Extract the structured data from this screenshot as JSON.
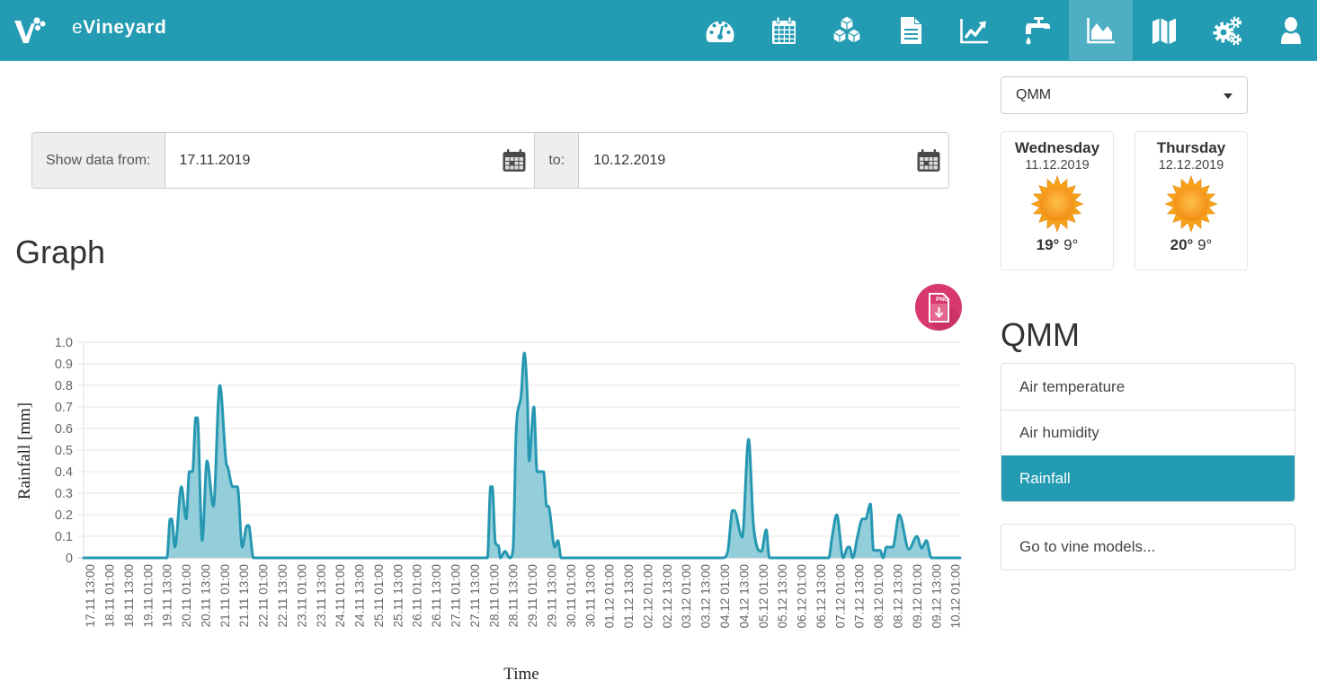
{
  "app": {
    "title_prefix": "e",
    "title_main": "Vineyard"
  },
  "nav": {
    "items": [
      {
        "name": "dashboard",
        "active": false
      },
      {
        "name": "calendar",
        "active": false
      },
      {
        "name": "cubes",
        "active": false
      },
      {
        "name": "documents",
        "active": false
      },
      {
        "name": "line-chart",
        "active": false
      },
      {
        "name": "irrigation",
        "active": false
      },
      {
        "name": "area-chart",
        "active": true
      },
      {
        "name": "map",
        "active": false
      },
      {
        "name": "settings",
        "active": false
      },
      {
        "name": "user",
        "active": false
      }
    ]
  },
  "date_range": {
    "from_label": "Show data from:",
    "from_value": "17.11.2019",
    "to_label": "to:",
    "to_value": "10.12.2019"
  },
  "graph": {
    "title": "Graph",
    "export_label": "PNG"
  },
  "station_select": {
    "value": "QMM"
  },
  "forecast": [
    {
      "day": "Wednesday",
      "date": "11.12.2019",
      "high": "19°",
      "low": "9°",
      "icon": "sunny"
    },
    {
      "day": "Thursday",
      "date": "12.12.2019",
      "high": "20°",
      "low": "9°",
      "icon": "sunny"
    }
  ],
  "sidebar": {
    "title": "QMM",
    "items": [
      {
        "label": "Air temperature",
        "active": false
      },
      {
        "label": "Air humidity",
        "active": false
      },
      {
        "label": "Rainfall",
        "active": true
      }
    ],
    "vine_models": "Go to vine models..."
  },
  "colors": {
    "brand": "#229bb3",
    "nav_active": "#4eafc4",
    "series_line": "#2698b2",
    "series_fill": "#8ecbd8",
    "export_button": "#d6386f",
    "sun": "#f7a21b"
  },
  "chart_data": {
    "type": "area",
    "title": "",
    "xlabel": "Time",
    "ylabel": "Rainfall [mm]",
    "xlim": [
      "17.11 09:00",
      "10.12 04:00"
    ],
    "ylim": [
      0,
      1.0
    ],
    "grid": true,
    "legend": "none",
    "y_ticks": [
      "0",
      "0.1",
      "0.2",
      "0.3",
      "0.4",
      "0.5",
      "0.6",
      "0.7",
      "0.8",
      "0.9",
      "1.0"
    ],
    "x_ticks": [
      "17.11 13:00",
      "18.11 01:00",
      "18.11 13:00",
      "19.11 01:00",
      "19.11 13:00",
      "20.11 01:00",
      "20.11 13:00",
      "21.11 01:00",
      "21.11 13:00",
      "22.11 01:00",
      "22.11 13:00",
      "23.11 01:00",
      "23.11 13:00",
      "24.11 01:00",
      "24.11 13:00",
      "25.11 01:00",
      "25.11 13:00",
      "26.11 01:00",
      "26.11 13:00",
      "27.11 01:00",
      "27.11 13:00",
      "28.11 01:00",
      "28.11 13:00",
      "29.11 01:00",
      "29.11 13:00",
      "30.11 01:00",
      "30.11 13:00",
      "01.12 01:00",
      "01.12 13:00",
      "02.12 01:00",
      "02.12 13:00",
      "03.12 01:00",
      "03.12 13:00",
      "04.12 01:00",
      "04.12 13:00",
      "05.12 01:00",
      "05.12 13:00",
      "06.12 01:00",
      "06.12 13:00",
      "07.12 01:00",
      "07.12 13:00",
      "08.12 01:00",
      "08.12 13:00",
      "09.12 01:00",
      "09.12 13:00",
      "10.12 01:00"
    ],
    "series": [
      {
        "name": "Rainfall",
        "points": [
          [
            "17.11 09:00",
            0
          ],
          [
            "19.11 13:00",
            0
          ],
          [
            "19.11 15:00",
            0.18
          ],
          [
            "19.11 16:00",
            0.18
          ],
          [
            "19.11 18:00",
            0.05
          ],
          [
            "19.11 22:00",
            0.33
          ],
          [
            "20.11 01:00",
            0.18
          ],
          [
            "20.11 03:00",
            0.4
          ],
          [
            "20.11 05:00",
            0.4
          ],
          [
            "20.11 07:00",
            0.65
          ],
          [
            "20.11 08:00",
            0.65
          ],
          [
            "20.11 11:00",
            0.08
          ],
          [
            "20.11 14:00",
            0.45
          ],
          [
            "20.11 18:00",
            0.24
          ],
          [
            "20.11 22:00",
            0.8
          ],
          [
            "21.11 02:00",
            0.44
          ],
          [
            "21.11 03:00",
            0.42
          ],
          [
            "21.11 06:00",
            0.33
          ],
          [
            "21.11 09:00",
            0.33
          ],
          [
            "21.11 12:00",
            0.05
          ],
          [
            "21.11 15:00",
            0.15
          ],
          [
            "21.11 16:00",
            0.15
          ],
          [
            "21.11 19:00",
            0
          ],
          [
            "27.11 21:00",
            0
          ],
          [
            "27.11 23:00",
            0.33
          ],
          [
            "28.11 00:00",
            0.33
          ],
          [
            "28.11 02:00",
            0.07
          ],
          [
            "28.11 04:00",
            0.055
          ],
          [
            "28.11 05:00",
            0
          ],
          [
            "28.11 08:00",
            0.03
          ],
          [
            "28.11 11:00",
            0
          ],
          [
            "28.11 13:00",
            0.04
          ],
          [
            "28.11 15:00",
            0.6
          ],
          [
            "28.11 18:00",
            0.75
          ],
          [
            "28.11 20:00",
            0.95
          ],
          [
            "28.11 22:00",
            0.73
          ],
          [
            "28.11 23:00",
            0.45
          ],
          [
            "29.11 02:00",
            0.7
          ],
          [
            "29.11 04:00",
            0.4
          ],
          [
            "29.11 08:00",
            0.4
          ],
          [
            "29.11 10:00",
            0.24
          ],
          [
            "29.11 11:00",
            0.24
          ],
          [
            "29.11 15:00",
            0.05
          ],
          [
            "29.11 17:00",
            0.08
          ],
          [
            "29.11 19:00",
            0
          ],
          [
            "04.12 00:00",
            0
          ],
          [
            "04.12 03:00",
            0.03
          ],
          [
            "04.12 06:00",
            0.22
          ],
          [
            "04.12 07:00",
            0.22
          ],
          [
            "04.12 12:00",
            0.095
          ],
          [
            "04.12 16:00",
            0.55
          ],
          [
            "04.12 19:00",
            0.155
          ],
          [
            "05.12 00:00",
            0.03
          ],
          [
            "05.12 03:00",
            0.13
          ],
          [
            "05.12 05:00",
            0
          ],
          [
            "06.12 18:00",
            0
          ],
          [
            "06.12 20:00",
            0.09
          ],
          [
            "06.12 23:00",
            0.2
          ],
          [
            "07.12 03:00",
            0
          ],
          [
            "07.12 06:00",
            0.05
          ],
          [
            "07.12 07:00",
            0.05
          ],
          [
            "07.12 09:00",
            0
          ],
          [
            "07.12 12:00",
            0.1
          ],
          [
            "07.12 15:00",
            0.18
          ],
          [
            "07.12 17:00",
            0.18
          ],
          [
            "07.12 20:00",
            0.25
          ],
          [
            "07.12 22:00",
            0.035
          ],
          [
            "08.12 02:00",
            0.035
          ],
          [
            "08.12 04:00",
            0
          ],
          [
            "08.12 06:00",
            0.05
          ],
          [
            "08.12 10:00",
            0.05
          ],
          [
            "08.12 14:00",
            0.2
          ],
          [
            "08.12 20:00",
            0.04
          ],
          [
            "09.12 01:00",
            0.1
          ],
          [
            "09.12 04:00",
            0.045
          ],
          [
            "09.12 07:00",
            0.08
          ],
          [
            "09.12 10:00",
            0
          ],
          [
            "10.12 04:00",
            0
          ]
        ]
      }
    ]
  }
}
